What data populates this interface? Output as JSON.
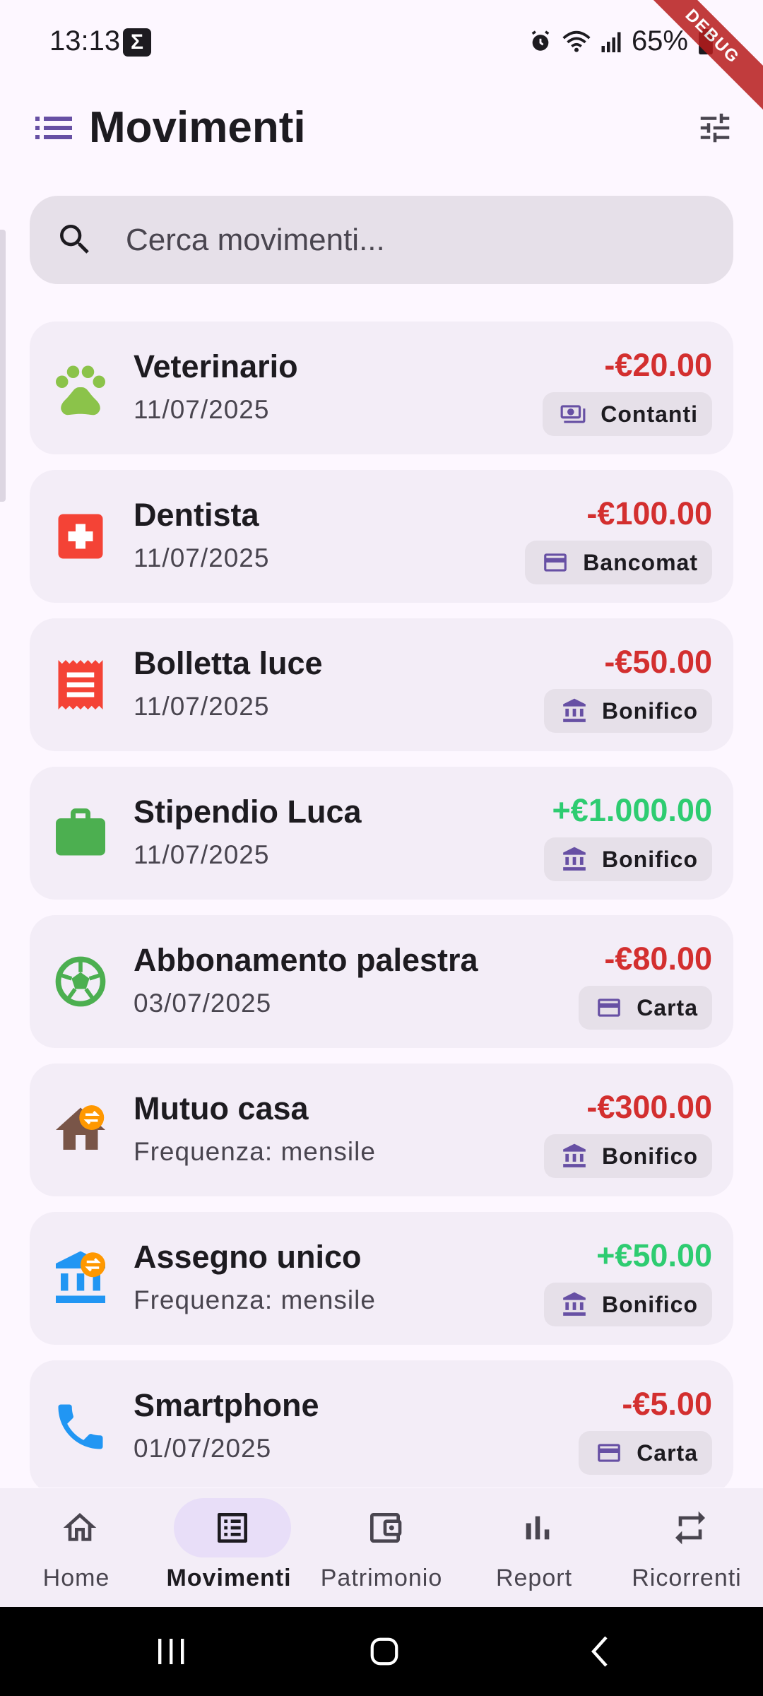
{
  "status_bar": {
    "time": "13:13",
    "battery": "65%",
    "icons": [
      "app-sigma-icon",
      "alarm-icon",
      "wifi-icon",
      "signal-icon",
      "battery-icon"
    ]
  },
  "debug_banner": "DEBUG",
  "app_bar": {
    "title": "Movimenti",
    "menu_icon": "menu-list-icon",
    "filter_icon": "tune-icon"
  },
  "search": {
    "placeholder": "Cerca movimenti..."
  },
  "colors": {
    "negative": "#D32F2F",
    "positive": "#2ECC71",
    "accent": "#6750A4"
  },
  "transactions": [
    {
      "title": "Veterinario",
      "subtitle": "11/07/2025",
      "amount": "-€20.00",
      "type": "negative",
      "method": "Contanti",
      "method_icon": "cash-icon",
      "icon": "paw-icon"
    },
    {
      "title": "Dentista",
      "subtitle": "11/07/2025",
      "amount": "-€100.00",
      "type": "negative",
      "method": "Bancomat",
      "method_icon": "card-icon",
      "icon": "medical-cross-icon"
    },
    {
      "title": "Bolletta luce",
      "subtitle": "11/07/2025",
      "amount": "-€50.00",
      "type": "negative",
      "method": "Bonifico",
      "method_icon": "bank-icon",
      "icon": "receipt-icon"
    },
    {
      "title": "Stipendio Luca",
      "subtitle": "11/07/2025",
      "amount": "+€1.000.00",
      "type": "positive",
      "method": "Bonifico",
      "method_icon": "bank-icon",
      "icon": "briefcase-icon"
    },
    {
      "title": "Abbonamento palestra",
      "subtitle": "03/07/2025",
      "amount": "-€80.00",
      "type": "negative",
      "method": "Carta",
      "method_icon": "card-icon",
      "icon": "soccer-ball-icon"
    },
    {
      "title": "Mutuo casa",
      "subtitle": "Frequenza: mensile",
      "amount": "-€300.00",
      "type": "negative",
      "method": "Bonifico",
      "method_icon": "bank-icon",
      "icon": "house-recurring-icon"
    },
    {
      "title": "Assegno unico",
      "subtitle": "Frequenza: mensile",
      "amount": "+€50.00",
      "type": "positive",
      "method": "Bonifico",
      "method_icon": "bank-icon",
      "icon": "bank-recurring-icon"
    },
    {
      "title": "Smartphone",
      "subtitle": "01/07/2025",
      "amount": "-€5.00",
      "type": "negative",
      "method": "Carta",
      "method_icon": "card-icon",
      "icon": "phone-icon"
    }
  ],
  "bottom_nav": [
    {
      "label": "Home",
      "icon": "home-icon",
      "active": false
    },
    {
      "label": "Movimenti",
      "icon": "list-alt-icon",
      "active": true
    },
    {
      "label": "Patrimonio",
      "icon": "wallet-icon",
      "active": false
    },
    {
      "label": "Report",
      "icon": "bar-chart-icon",
      "active": false
    },
    {
      "label": "Ricorrenti",
      "icon": "repeat-icon",
      "active": false
    }
  ]
}
